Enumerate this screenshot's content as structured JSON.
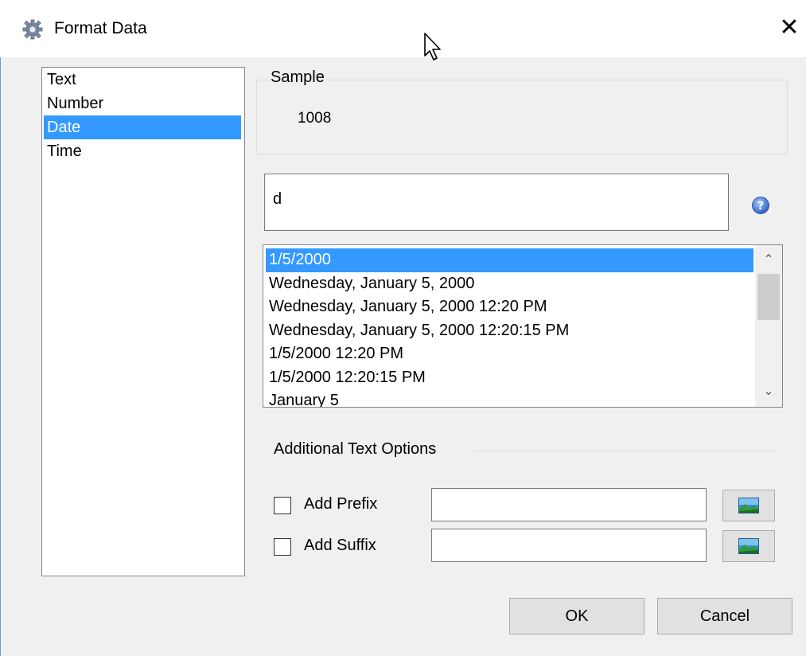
{
  "window": {
    "title": "Format Data",
    "close_symbol": "✕",
    "icon": "gear-icon"
  },
  "categories": {
    "items": [
      {
        "label": "Text",
        "selected": false
      },
      {
        "label": "Number",
        "selected": false
      },
      {
        "label": "Date",
        "selected": true
      },
      {
        "label": "Time",
        "selected": false
      }
    ]
  },
  "sample": {
    "legend": "Sample",
    "value": "1008"
  },
  "format_input": {
    "value": "d"
  },
  "help_icon": "question-mark-icon",
  "format_list": {
    "items": [
      {
        "label": "1/5/2000",
        "selected": true
      },
      {
        "label": "Wednesday, January 5, 2000",
        "selected": false
      },
      {
        "label": "Wednesday, January 5, 2000 12:20 PM",
        "selected": false
      },
      {
        "label": "Wednesday, January 5, 2000 12:20:15 PM",
        "selected": false
      },
      {
        "label": "1/5/2000 12:20 PM",
        "selected": false
      },
      {
        "label": "1/5/2000 12:20:15 PM",
        "selected": false
      },
      {
        "label": "January 5",
        "selected": false
      }
    ],
    "scroll_up_symbol": "⌃",
    "scroll_down_symbol": "⌄"
  },
  "additional": {
    "heading": "Additional Text Options",
    "prefix": {
      "label": "Add Prefix",
      "checked": false,
      "value": ""
    },
    "suffix": {
      "label": "Add Suffix",
      "checked": false,
      "value": ""
    }
  },
  "buttons": {
    "ok": "OK",
    "cancel": "Cancel"
  },
  "colors": {
    "selection": "#3399ff",
    "dialog_bg": "#f0f0f0",
    "button_bg": "#e1e1e1"
  }
}
